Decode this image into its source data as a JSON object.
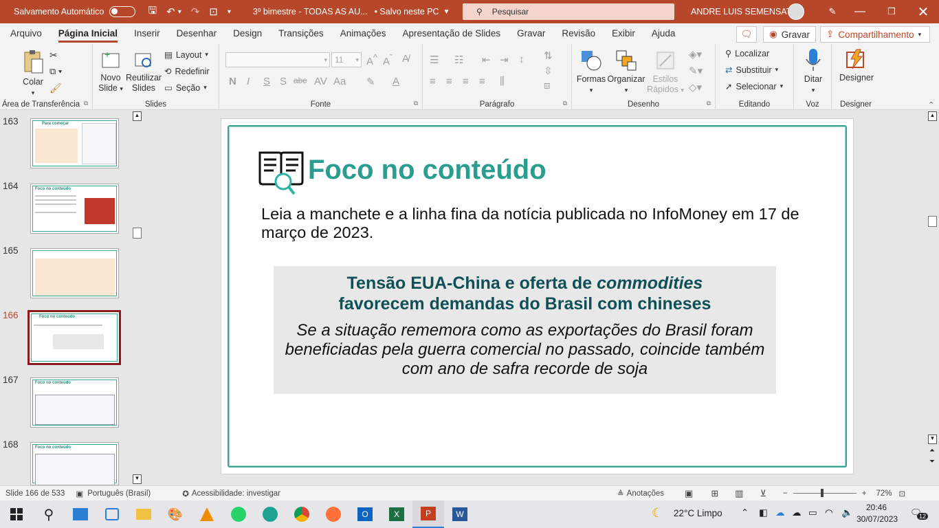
{
  "titlebar": {
    "autosave_label": "Salvamento Automático",
    "doc_title": "3º bimestre - TODAS AS AU...",
    "save_status": "• Salvo neste PC",
    "search_placeholder": "Pesquisar",
    "user_name": "ANDRE LUIS SEMENSATO",
    "accent": "#b7472a"
  },
  "menu": {
    "tabs": [
      "Arquivo",
      "Página Inicial",
      "Inserir",
      "Desenhar",
      "Design",
      "Transições",
      "Animações",
      "Apresentação de Slides",
      "Gravar",
      "Revisão",
      "Exibir",
      "Ajuda"
    ],
    "record_button": "Gravar",
    "share_button": "Compartilhamento"
  },
  "ribbon": {
    "clipboard": {
      "paste": "Colar",
      "label": "Área de Transferência"
    },
    "slides": {
      "new_slide_1": "Novo",
      "new_slide_2": "Slide",
      "reuse_1": "Reutilizar",
      "reuse_2": "Slides",
      "layout": "Layout",
      "reset": "Redefinir",
      "section": "Seção",
      "label": "Slides"
    },
    "font": {
      "size": "11",
      "bold": "N",
      "italic": "I",
      "underline": "S",
      "shadow": "S",
      "strike": "abc",
      "label": "Fonte"
    },
    "paragraph": {
      "label": "Parágrafo"
    },
    "drawing": {
      "shapes": "Formas",
      "arrange": "Organizar",
      "styles_1": "Estilos",
      "styles_2": "Rápidos",
      "label": "Desenho"
    },
    "editing": {
      "find": "Localizar",
      "replace": "Substituir",
      "select": "Selecionar",
      "label": "Editando"
    },
    "voice": {
      "dictate": "Ditar",
      "label": "Voz"
    },
    "designer": {
      "button": "Designer",
      "label": "Designer"
    }
  },
  "thumbnails": [
    {
      "number": "163",
      "title": "Para começar"
    },
    {
      "number": "164",
      "title": "Foco no conteúdo"
    },
    {
      "number": "165",
      "title": ""
    },
    {
      "number": "166",
      "title": "Foco no conteúdo"
    },
    {
      "number": "167",
      "title": "Foco no conteúdo"
    },
    {
      "number": "168",
      "title": "Foco no conteúdo"
    }
  ],
  "slide": {
    "title": "Foco no conteúdo",
    "intro": "Leia a manchete e a linha fina da notícia publicada no InfoMoney em 17 de março de 2023.",
    "headline_part1": "Tensão EUA-China e oferta de ",
    "headline_italic": "commodities",
    "headline_part2": "favorecem demandas do Brasil com chineses",
    "subline": "Se a situação rememora como as exportações do Brasil foram beneficiadas pela guerra comercial no passado, coincide também com ano de safra recorde de soja",
    "accent": "#2a9d8f"
  },
  "status": {
    "slide_count": "Slide 166 de 533",
    "language": "Português (Brasil)",
    "accessibility": "Acessibilidade: investigar",
    "notes": "Anotações",
    "zoom": "72%"
  },
  "taskbar": {
    "weather": "22°C  Limpo",
    "time": "20:46",
    "date": "30/07/2023",
    "notifications": "12"
  }
}
